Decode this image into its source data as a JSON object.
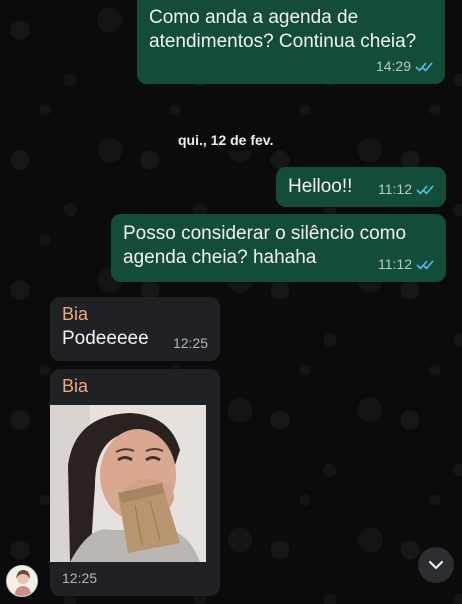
{
  "messages": [
    {
      "direction": "out",
      "text": "Como anda a agenda de\natendimentos? Continua cheia?",
      "time": "14:29",
      "status": "read"
    },
    {
      "direction": "out",
      "text": "Helloo!!",
      "time": "11:12",
      "status": "read"
    },
    {
      "direction": "out",
      "text": "Posso considerar o silêncio como\nagenda cheia? hahaha",
      "time": "11:12",
      "status": "read"
    },
    {
      "direction": "in",
      "sender": "Bia",
      "text": "Podeeeee",
      "time": "12:25"
    },
    {
      "direction": "in",
      "sender": "Bia",
      "type": "image",
      "time": "12:25"
    }
  ],
  "day_separator": "qui., 12 de fev.",
  "colors": {
    "outgoing_bubble": "#134d37",
    "incoming_bubble": "#1f2124",
    "sender_name": "#f0a67a",
    "read_ticks": "#53bdeb",
    "background": "#0b0b0b"
  },
  "icons": {
    "read_receipt": "double-check-icon",
    "scroll_down": "chevron-down-icon"
  }
}
